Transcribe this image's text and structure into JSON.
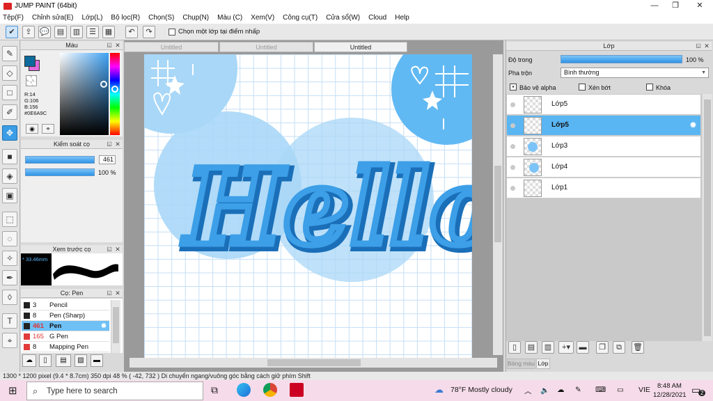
{
  "window": {
    "title": "JUMP PAINT (64bit)",
    "controls": [
      "—",
      "❐",
      "✕"
    ]
  },
  "menu": [
    "Tệp(F)",
    "Chỉnh sửa(E)",
    "Lớp(L)",
    "Bộ lọc(R)",
    "Chọn(S)",
    "Chụp(N)",
    "Màu (C)",
    "Xem(V)",
    "Công cụ(T)",
    "Cửa sổ(W)",
    "Cloud",
    "Help"
  ],
  "toolbar": {
    "checkbox_label": "Chọn một lớp tại điểm nhấp"
  },
  "color_panel": {
    "title": "Màu",
    "r": "R:14",
    "g": "G:106",
    "b": "B:156",
    "hex": "#0E6A9C",
    "main_color": "#0E6A9C",
    "sub_color": "#E06ADE"
  },
  "brush_control": {
    "title": "Kiểm soát cọ",
    "size": "461",
    "opacity": "100 %"
  },
  "brush_preview": {
    "title": "Xem trước cọ",
    "size_text": "* 33.46mm"
  },
  "brush_list": {
    "title": "Cọ: Pen",
    "items": [
      {
        "size": "3",
        "name": "Pencil",
        "color": "#222222"
      },
      {
        "size": "8",
        "name": "Pen (Sharp)",
        "color": "#222222"
      },
      {
        "size": "461",
        "name": "Pen",
        "color": "#222222"
      },
      {
        "size": "165",
        "name": "G Pen",
        "color": "#e23b3b"
      },
      {
        "size": "8",
        "name": "Mapping Pen",
        "color": "#e23b3b"
      }
    ]
  },
  "tabs": [
    "Untitled",
    "Untitled",
    "Untitled"
  ],
  "canvas": {
    "text": "Hello"
  },
  "layer_panel": {
    "title": "Lớp",
    "opacity_label": "Độ trong",
    "opacity_value": "100 %",
    "blend_label": "Pha trộn",
    "blend_value": "Bình thường",
    "protect_alpha": "Bảo vệ alpha",
    "clip": "Xén bớt",
    "lock": "Khóa",
    "layers": [
      {
        "name": "Lớp5",
        "selected": false
      },
      {
        "name": "Lớp5",
        "selected": true
      },
      {
        "name": "Lớp3",
        "selected": false
      },
      {
        "name": "Lớp4",
        "selected": false
      },
      {
        "name": "Lớp1",
        "selected": false
      }
    ],
    "bottom_tabs": [
      "Bảng màu",
      "Lớp"
    ]
  },
  "status": {
    "text": "1300 * 1200 pixel   (9.4 * 8.7cm)   350 dpi   48 %   ( -42, 732 )   Di chuyển ngang/vuông góc bằng cách giữ phím Shift"
  },
  "taskbar": {
    "search_placeholder": "Type here to search",
    "weather": "78°F  Mostly cloudy",
    "lang": "VIE",
    "time": "8:48 AM",
    "date": "12/28/2021",
    "notif_count": "2"
  }
}
